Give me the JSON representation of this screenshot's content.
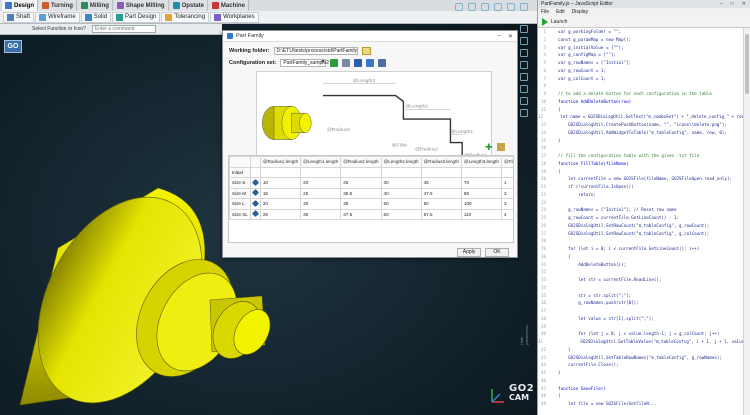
{
  "ribbon": {
    "tabs": [
      {
        "label": "Design",
        "color": "#3c78c8",
        "active": true
      },
      {
        "label": "Turning",
        "color": "#d25a28"
      },
      {
        "label": "Milling",
        "color": "#2e8b57"
      },
      {
        "label": "Shape Milling",
        "color": "#8a5fb8"
      },
      {
        "label": "Opstate",
        "color": "#1f8fa8"
      },
      {
        "label": "Machine",
        "color": "#c23a3a"
      }
    ],
    "tools": [
      {
        "label": "Shaft",
        "color": "#4f7fb8"
      },
      {
        "label": "Wireframe",
        "color": "#5e9fd4"
      },
      {
        "label": "Solid",
        "color": "#3a86c9"
      },
      {
        "label": "Part Design",
        "color": "#2a9d8f"
      },
      {
        "label": "Tolerancing",
        "color": "#e2a23b"
      },
      {
        "label": "Workplanes",
        "color": "#7b61c4"
      }
    ]
  },
  "command_bar": {
    "label": "Select Function or Icon?",
    "placeholder": "Enter a command"
  },
  "go_button": "GO",
  "viewport": {
    "side_label": "Hide parameters",
    "logo_line1": "GO2",
    "logo_line2": "CAM",
    "part_color": "#e8e600"
  },
  "dialog": {
    "title": "Part Family",
    "working_folder_label": "Working folder:",
    "working_folder_value": "D:\\ETU\\tests\\process\\std\\PartFamily\\",
    "config_label": "Configuration set:",
    "config_value": "PartFamily_sample2",
    "sketch_labels": {
      "length3": "@Length3",
      "length2": "@Length2",
      "length1": "@Length1",
      "radius3": "@Radius3",
      "radius2": "@Radius2",
      "radius1": "@Radius1",
      "fillet": "@Fillet"
    },
    "table": {
      "columns": [
        "@Radius1.length",
        "@Length1.length",
        "@Radius2.length",
        "@Length2.length",
        "@Radius3.length",
        "@Length3.length",
        "@Fillet.radius"
      ],
      "rows": [
        {
          "name": "Initial",
          "values": [
            "",
            "",
            "",
            "",
            "",
            "",
            ""
          ]
        },
        {
          "name": "Size S",
          "values": [
            "10",
            "20",
            "25",
            "30",
            "45",
            "70",
            "1"
          ]
        },
        {
          "name": "Size M",
          "values": [
            "15",
            "25",
            "35.5",
            "40",
            "47.5",
            "90",
            "2"
          ]
        },
        {
          "name": "Size L",
          "values": [
            "20",
            "30",
            "35",
            "50",
            "50",
            "100",
            "3"
          ]
        },
        {
          "name": "Size XL",
          "values": [
            "25",
            "35",
            "37.5",
            "60",
            "57.5",
            "110",
            "4"
          ]
        }
      ]
    },
    "apply_label": "Apply",
    "ok_label": "OK"
  },
  "editor": {
    "title": "PartFamily.js – JavaScript Editor",
    "menu": [
      "File",
      "Edit",
      "Display"
    ],
    "launch_label": "Launch",
    "code": [
      {
        "n": "1",
        "t": "  var g_workingFolder = \"\";",
        "k": "src"
      },
      {
        "n": "2",
        "t": "  const g_paramMap = new Map();",
        "k": "src"
      },
      {
        "n": "3",
        "t": "  var g_initialValue = [\"\"];",
        "k": "src"
      },
      {
        "n": "4",
        "t": "  var g_configMap = [\"\"];",
        "k": "src"
      },
      {
        "n": "5",
        "t": "  var g_rowNames = [\"Initial\"];",
        "k": "src"
      },
      {
        "n": "6",
        "t": "  var g_rowCount = 1;",
        "k": "src"
      },
      {
        "n": "7",
        "t": "  var g_colCount = 1;",
        "k": "src"
      },
      {
        "n": "8",
        "t": "",
        "k": "src"
      },
      {
        "n": "9",
        "t": "  // to add a delete button for each configuration in the table",
        "k": "cm"
      },
      {
        "n": "10",
        "t": "  function AddDeleteButton(row)",
        "k": "kw"
      },
      {
        "n": "11",
        "t": "  {",
        "k": "src"
      },
      {
        "n": "12",
        "t": "      let name = GO2SDialogUtil.GetText(\"m_comboSet\") + \"_delete_config_\" + row;",
        "k": "src"
      },
      {
        "n": "13",
        "t": "      GO2SDialogUtil.CreatePushButton(name, \"\", \"icons\\\\delete.png\");",
        "k": "src"
      },
      {
        "n": "14",
        "t": "      GO2SDialogUtil.AddWidgetToTable(\"m_tableConfig\", name, row, 0);",
        "k": "src"
      },
      {
        "n": "15",
        "t": "  }",
        "k": "src"
      },
      {
        "n": "16",
        "t": "",
        "k": "src"
      },
      {
        "n": "17",
        "t": "  // fill the configuration table with the given .txt file",
        "k": "cm"
      },
      {
        "n": "18",
        "t": "  function FillTable(fileName)",
        "k": "kw"
      },
      {
        "n": "19",
        "t": "  {",
        "k": "src"
      },
      {
        "n": "20",
        "t": "      let currentFile = new GO2SFile(fileName, GO2SFileOpen.read_only);",
        "k": "src"
      },
      {
        "n": "21",
        "t": "      if (!currentFile.IsOpen())",
        "k": "src"
      },
      {
        "n": "22",
        "t": "          return;",
        "k": "src"
      },
      {
        "n": "23",
        "t": "",
        "k": "src"
      },
      {
        "n": "24",
        "t": "      g_rowNames = [\"Initial\"]; // Reset row name",
        "k": "src"
      },
      {
        "n": "25",
        "t": "      g_rowCount = currentFile.GetLineCount() - 1;",
        "k": "src"
      },
      {
        "n": "26",
        "t": "      GO2SDialogUtil.SetRowCount(\"m_tableConfig\", g_rowCount);",
        "k": "src"
      },
      {
        "n": "27",
        "t": "      GO2SDialogUtil.SetRowCount(\"m_tableConfig\", g_colCount);",
        "k": "src"
      },
      {
        "n": "28",
        "t": "",
        "k": "src"
      },
      {
        "n": "29",
        "t": "      for (let i = 0; i < currentFile.GetLineCount(); i++)",
        "k": "src"
      },
      {
        "n": "30",
        "t": "      {",
        "k": "src"
      },
      {
        "n": "31",
        "t": "          AddDeleteButton(i);",
        "k": "src"
      },
      {
        "n": "32",
        "t": "",
        "k": "src"
      },
      {
        "n": "33",
        "t": "          let str = currentFile.ReadLine();",
        "k": "src"
      },
      {
        "n": "34",
        "t": "",
        "k": "src"
      },
      {
        "n": "35",
        "t": "          str = str.split(\";\");",
        "k": "src"
      },
      {
        "n": "36",
        "t": "          g_rowNames.push(str[0]);",
        "k": "src"
      },
      {
        "n": "37",
        "t": "",
        "k": "src"
      },
      {
        "n": "38",
        "t": "          let value = str[1].split(\";\");",
        "k": "src"
      },
      {
        "n": "39",
        "t": "",
        "k": "src"
      },
      {
        "n": "40",
        "t": "          for (let j = 0; j < value.length-1; j = g_colCount; j++)",
        "k": "src"
      },
      {
        "n": "41",
        "t": "              GO2SDialogUtil.SetTableValue(\"m_tableConfig\", i + 1, j + 1, value[j]);",
        "k": "src"
      },
      {
        "n": "42",
        "t": "      }",
        "k": "src"
      },
      {
        "n": "43",
        "t": "      GO2SDialogUtil.SetTableRowNames(\"m_tableConfig\", g_rowNames);",
        "k": "src"
      },
      {
        "n": "44",
        "t": "      currentFile.Close();",
        "k": "src"
      },
      {
        "n": "45",
        "t": "  }",
        "k": "src"
      },
      {
        "n": "46",
        "t": "",
        "k": "src"
      },
      {
        "n": "47",
        "t": "  function SaveFile()",
        "k": "kw"
      },
      {
        "n": "48",
        "t": "  {",
        "k": "src"
      },
      {
        "n": "49",
        "t": "      let file = new GO2SFile(GetFileN...",
        "k": "src"
      }
    ]
  }
}
